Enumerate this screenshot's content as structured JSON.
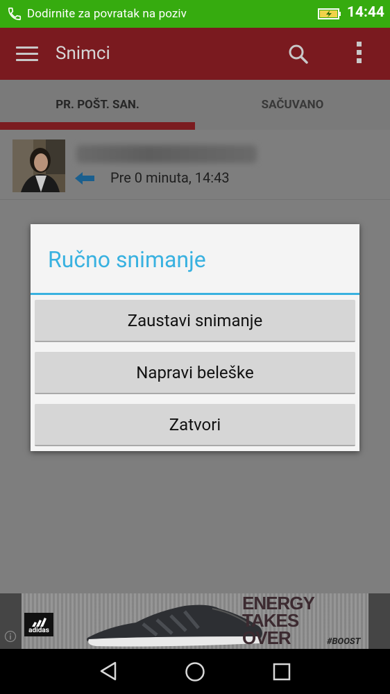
{
  "status_bar": {
    "message": "Dodirnite za povratak na poziv",
    "time": "14:44",
    "color": "#36ab0f",
    "icons": [
      "phone-icon",
      "battery-charging-icon"
    ]
  },
  "app_bar": {
    "title": "Snimci",
    "icons": [
      "menu-icon",
      "search-icon",
      "more-vert-icon"
    ]
  },
  "tabs": [
    {
      "label": "PR. POŠT. SAN.",
      "selected": true
    },
    {
      "label": "SAČUVANO",
      "selected": false
    }
  ],
  "recordings": [
    {
      "contact_name": "",
      "direction_icon": "outgoing-call-arrow-icon",
      "time": "Pre 0 minuta, 14:43"
    }
  ],
  "dialog": {
    "title": "Ručno snimanje",
    "accent": "#38b1e0",
    "buttons": [
      "Zaustavi snimanje",
      "Napravi beleške",
      "Zatvori"
    ]
  },
  "ad": {
    "brand": "adidas",
    "slogan": "ENERGY TAKES OVER",
    "tag": "#BOOST"
  },
  "nav_bar": {
    "icons": [
      "back-icon",
      "home-icon",
      "recents-icon"
    ]
  }
}
